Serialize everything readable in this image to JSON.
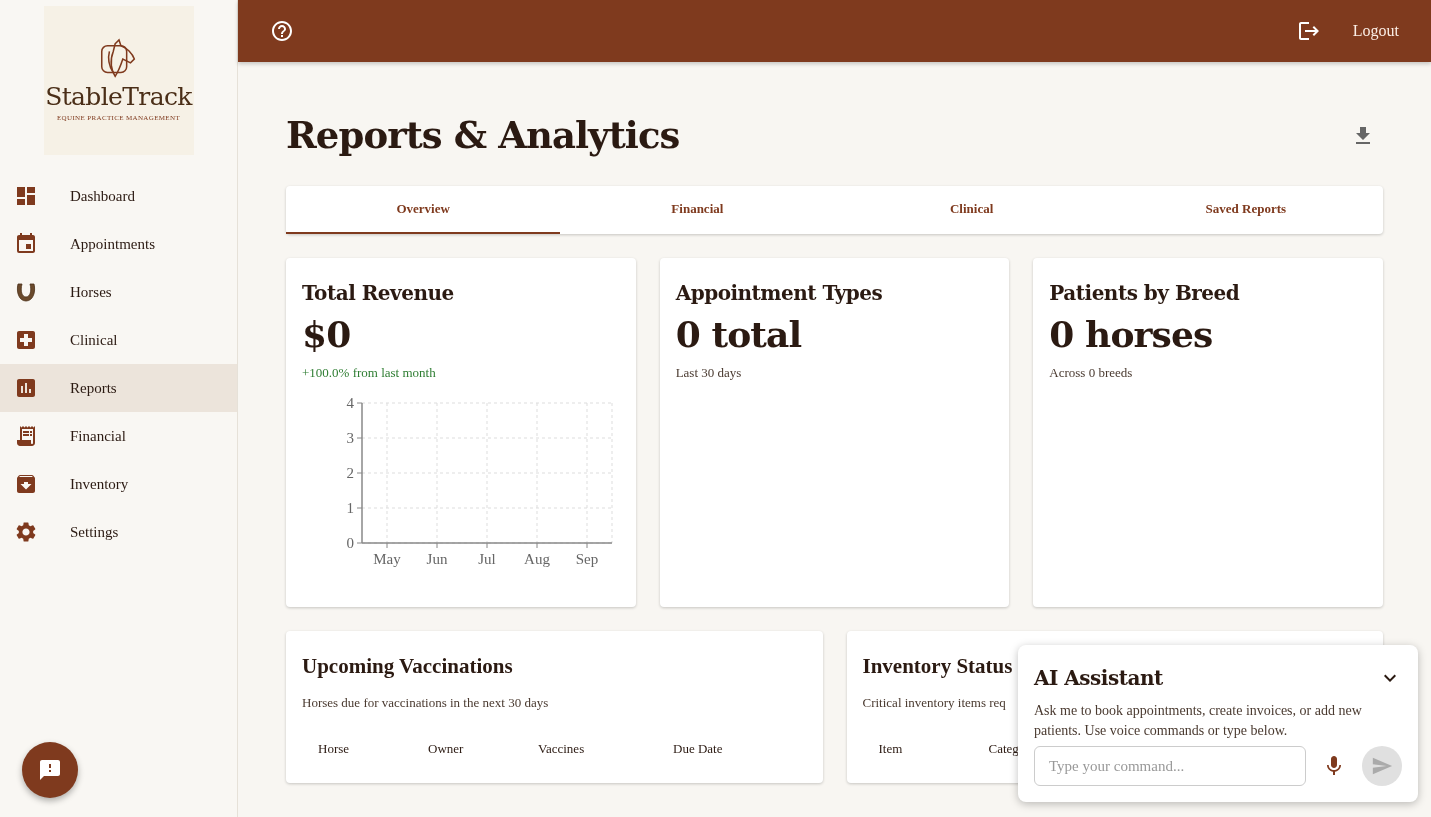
{
  "brand": {
    "name": "StableTrack",
    "tagline": "EQUINE PRACTICE MANAGEMENT"
  },
  "sidebar": {
    "items": [
      {
        "label": "Dashboard",
        "kind": "dashboard",
        "selected": false
      },
      {
        "label": "Appointments",
        "kind": "calendar",
        "selected": false
      },
      {
        "label": "Horses",
        "kind": "horseshoe",
        "selected": false
      },
      {
        "label": "Clinical",
        "kind": "clinical",
        "selected": false
      },
      {
        "label": "Reports",
        "kind": "reports",
        "selected": true
      },
      {
        "label": "Financial",
        "kind": "receipt",
        "selected": false
      },
      {
        "label": "Inventory",
        "kind": "archive",
        "selected": false
      },
      {
        "label": "Settings",
        "kind": "gear",
        "selected": false
      }
    ]
  },
  "header": {
    "logout": "Logout"
  },
  "page": {
    "title": "Reports & Analytics"
  },
  "tabs": [
    {
      "label": "Overview",
      "selected": true
    },
    {
      "label": "Financial",
      "selected": false
    },
    {
      "label": "Clinical",
      "selected": false
    },
    {
      "label": "Saved Reports",
      "selected": false
    }
  ],
  "stat_cards": [
    {
      "title": "Total Revenue",
      "value": "$0",
      "note": "+100.0% from last month",
      "kind": "change",
      "chart_data": {
        "type": "line",
        "categories": [
          "May",
          "Jun",
          "Jul",
          "Aug",
          "Sep"
        ],
        "ylim": [
          0,
          4
        ],
        "yticks": [
          0,
          1,
          2,
          3,
          4
        ],
        "grid": true
      }
    },
    {
      "title": "Appointment Types",
      "value": "0 total",
      "note": "Last 30 days",
      "kind": "caption"
    },
    {
      "title": "Patients by Breed",
      "value": "0 horses",
      "note": "Across 0 breeds",
      "kind": "caption"
    }
  ],
  "table_cards": [
    {
      "title": "Upcoming Vaccinations",
      "subtitle": "Horses due for vaccinations in the next 30 days",
      "columns": [
        "Horse",
        "Owner",
        "Vaccines",
        "Due Date"
      ]
    },
    {
      "title": "Inventory Status",
      "subtitle": "Critical inventory items req",
      "columns": [
        "Item",
        "Categ"
      ]
    }
  ],
  "assistant": {
    "title": "AI Assistant",
    "description": "Ask me to book appointments, create invoices, or add new patients. Use voice commands or type below.",
    "placeholder": "Type your command..."
  }
}
